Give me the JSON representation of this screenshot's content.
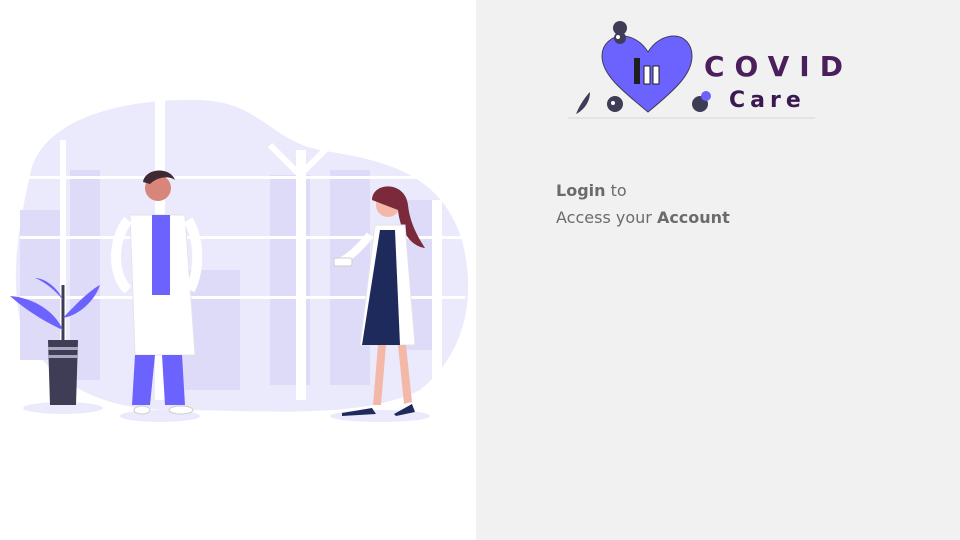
{
  "logo": {
    "word": "COVID",
    "sub": "Care"
  },
  "login": {
    "strong_word": "Login",
    "connector": "to",
    "prefix": "Access your",
    "strong_account": "Account"
  },
  "colors": {
    "accent": "#6c63ff",
    "background_right": "#f1f1f1",
    "text": "#6b6b6b",
    "logo_dark": "#4b1f5c"
  }
}
